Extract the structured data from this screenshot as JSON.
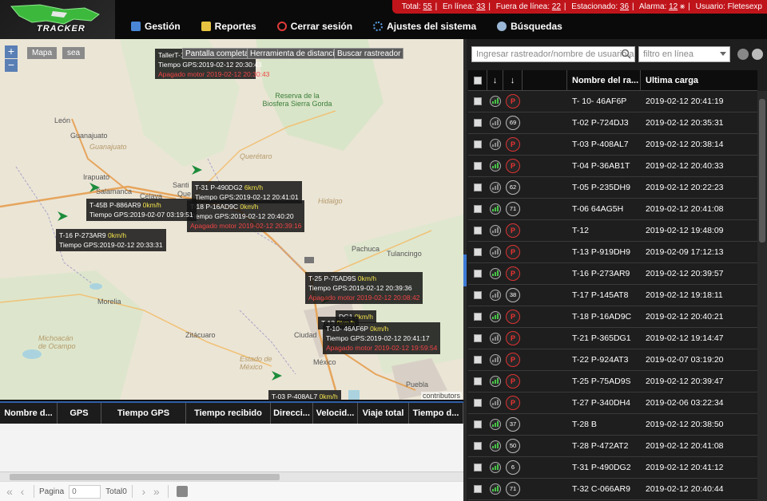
{
  "header": {
    "logo_text": "TRACKER",
    "nav": [
      {
        "label": "Gestión",
        "icon": "table-icon"
      },
      {
        "label": "Reportes",
        "icon": "report-icon"
      },
      {
        "label": "Cerrar sesión",
        "icon": "power-icon"
      },
      {
        "label": "Ajustes del sistema",
        "icon": "gear-icon"
      },
      {
        "label": "Búsquedas",
        "icon": "search-icon"
      }
    ],
    "status": {
      "total_label": "Total:",
      "total": "55",
      "online_label": "En línea:",
      "online": "33",
      "offline_label": "Fuera de línea:",
      "offline": "22",
      "parked_label": "Estacionado:",
      "parked": "36",
      "alarm_label": "Alarma:",
      "alarm": "12",
      "user_label": "Usuario:",
      "user": "Fletesexp"
    }
  },
  "map": {
    "zoom_in": "+",
    "zoom_out": "−",
    "layer_buttons": [
      "Mapa",
      "sea"
    ],
    "tools": [
      "Pantalla completa",
      "Herramienta de distancia",
      "Buscar rastreador"
    ],
    "attribution": "contributors",
    "place_labels": {
      "leon": "León",
      "guanajuato": "Guanajuato",
      "guanajuato_state": "Guanajuato",
      "irapuato": "Irapuato",
      "salamanca": "Salamanca",
      "celaya": "Celaya",
      "queretaro": "Querétaro",
      "hidalgo": "Hidalgo",
      "pachuca": "Pachuca",
      "tulancingo": "Tulancingo",
      "morelia": "Morelia",
      "zitacuaro": "Zitácuaro",
      "michoacan": "Michoacán de Ocampo",
      "estado_mexico": "Estado de México",
      "ciudad": "Ciudad",
      "mexico": "México",
      "puebla": "Puebla",
      "reserva": "Reserva de la Biosfera Sierra Gorda",
      "santiago": "Santi",
      "queretaro_city": "Que"
    },
    "tooltips": {
      "t1": {
        "a": "TallerT-15",
        "b": "Tiempo GPS:2019-02-12 20:30:43",
        "c": "Apagado motor 2019-02-12 20:30:43"
      },
      "t2": {
        "name": "T-31 P-490DG2",
        "speed": "6km/h",
        "gps": "Tiempo GPS:2019-02-12 20:41:01"
      },
      "t3": {
        "name": "T-18 P-16AD9C",
        "speed": "0km/h",
        "gps": "Tiempo GPS:2019-02-12 20:40:20",
        "alarm": "Apagado motor 2019-02-12 20:39:16"
      },
      "t4": {
        "name": "T-45B P-886AR9",
        "speed": "0km/h",
        "gps": "Tiempo GPS:2019-02-07 03:19:51"
      },
      "t5": {
        "name": "T-16 P-273AR9",
        "speed": "0km/h",
        "gps": "Tiempo GPS:2019-02-12 20:33:31"
      },
      "t6": {
        "name": "T-25 P-75AD9S",
        "speed": "0km/h",
        "gps": "Tiempo GPS:2019-02-12 20:39:36",
        "alarm": "Apagado motor 2019-02-12 20:08:42"
      },
      "t7": {
        "name": "T-10- 46AF6P",
        "speed": "0km/h",
        "gps": "Tiempo GPS:2019-02-12 20:41:17",
        "alarm": "Apagado motor 2019-02-12 19:59:54"
      },
      "t8": {
        "name": "T-03 P-408AL7",
        "speed": "0km/h"
      },
      "t9": {
        "a": "DG1",
        "b": "0km/h"
      },
      "t10": {
        "a": "T-13",
        "b": "0km/h"
      }
    }
  },
  "bottom_table": {
    "columns": [
      "Nombre d...",
      "GPS",
      "Tiempo GPS",
      "Tiempo recibido",
      "Direcci...",
      "Velocid...",
      "Viaje total",
      "Tiempo d..."
    ],
    "pager": {
      "page_label": "Pagina",
      "page_value": "0",
      "total_label": "Total0"
    }
  },
  "right_panel": {
    "search_placeholder": "Ingresar rastreador/nombre de usuario a",
    "filter_placeholder": "filtro en línea",
    "columns": {
      "sort1": "↓",
      "sort2": "↓",
      "name": "Nombre del ra...",
      "last": "Ultima carga"
    },
    "rows": [
      {
        "name": "T- 10- 46AF6P",
        "time": "2019-02-12 20:41:19",
        "badge": "P",
        "sig": "green"
      },
      {
        "name": "T-02 P-724DJ3",
        "time": "2019-02-12 20:35:31",
        "badge": "69",
        "sig": "gray"
      },
      {
        "name": "T-03 P-408AL7",
        "time": "2019-02-12 20:38:14",
        "badge": "P",
        "sig": "gray"
      },
      {
        "name": "T-04 P-36AB1T",
        "time": "2019-02-12 20:40:33",
        "badge": "P",
        "sig": "green"
      },
      {
        "name": "T-05 P-235DH9",
        "time": "2019-02-12 20:22:23",
        "badge": "62",
        "sig": "gray"
      },
      {
        "name": "T-06 64AG5H",
        "time": "2019-02-12 20:41:08",
        "badge": "71",
        "sig": "green"
      },
      {
        "name": "T-12",
        "time": "2019-02-12 19:48:09",
        "badge": "P",
        "sig": "gray"
      },
      {
        "name": "T-13 P-919DH9",
        "time": "2019-02-09 17:12:13",
        "badge": "P",
        "sig": "gray"
      },
      {
        "name": "T-16 P-273AR9",
        "time": "2019-02-12 20:39:57",
        "badge": "P",
        "sig": "green"
      },
      {
        "name": "T-17 P-145AT8",
        "time": "2019-02-12 19:18:11",
        "badge": "38",
        "sig": "gray"
      },
      {
        "name": "T-18 P-16AD9C",
        "time": "2019-02-12 20:40:21",
        "badge": "P",
        "sig": "green"
      },
      {
        "name": "T-21 P-365DG1",
        "time": "2019-02-12 19:14:47",
        "badge": "P",
        "sig": "gray"
      },
      {
        "name": "T-22 P-924AT3",
        "time": "2019-02-07 03:19:20",
        "badge": "P",
        "sig": "gray"
      },
      {
        "name": "T-25 P-75AD9S",
        "time": "2019-02-12 20:39:47",
        "badge": "P",
        "sig": "green"
      },
      {
        "name": "T-27 P-340DH4",
        "time": "2019-02-06 03:22:34",
        "badge": "P",
        "sig": "gray"
      },
      {
        "name": "T-28 B",
        "time": "2019-02-12 20:38:50",
        "badge": "37",
        "sig": "green"
      },
      {
        "name": "T-28 P-472AT2",
        "time": "2019-02-12 20:41:08",
        "badge": "50",
        "sig": "green"
      },
      {
        "name": "T-31 P-490DG2",
        "time": "2019-02-12 20:41:12",
        "badge": "6",
        "sig": "green"
      },
      {
        "name": "T-32 C-066AR9",
        "time": "2019-02-12 20:40:44",
        "badge": "71",
        "sig": "green"
      }
    ]
  }
}
